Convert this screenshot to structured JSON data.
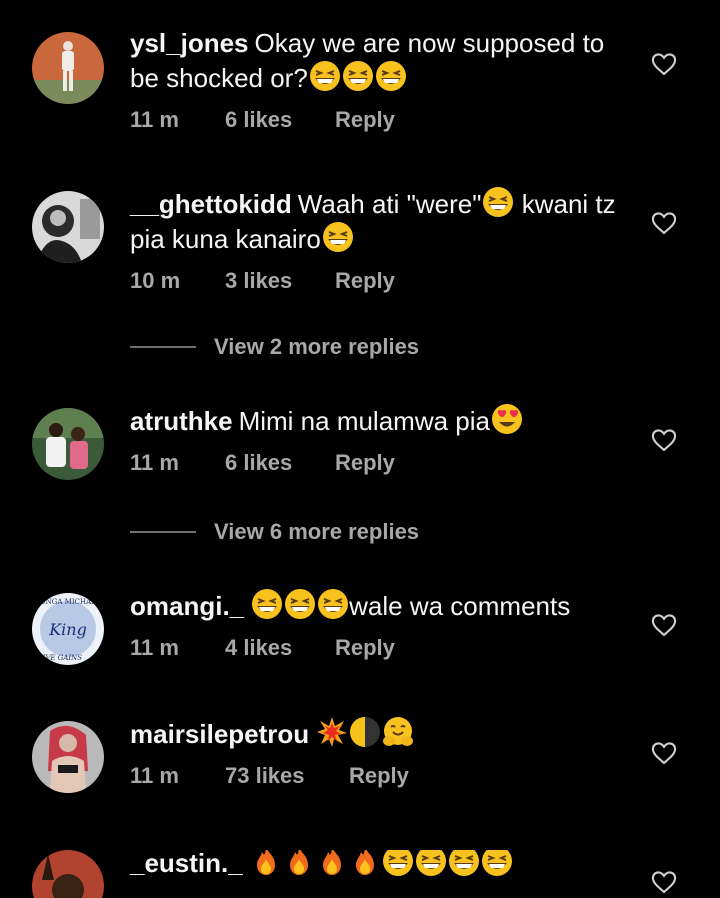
{
  "comments": [
    {
      "username": "ysl_jones",
      "text": "Okay we are now supposed to be shocked or?",
      "emojis_after": [
        "grinning-squint-emoji",
        "grinning-squint-emoji",
        "grinning-squint-emoji"
      ],
      "time": "11 m",
      "likes": "6 likes",
      "reply": "Reply"
    },
    {
      "username": "__ghettokidd",
      "text_a": "Waah ati \"were\"",
      "text_b": " kwani tz pia kuna kanairo",
      "time": "10 m",
      "likes": "3 likes",
      "reply": "Reply",
      "view_more": "View 2 more replies"
    },
    {
      "username": "atruthke",
      "text": "Mimi na mulamwa pia",
      "time": "11 m",
      "likes": "6 likes",
      "reply": "Reply",
      "view_more": "View 6 more replies"
    },
    {
      "username": "omangi._",
      "text": "wale wa comments",
      "time": "11 m",
      "likes": "4 likes",
      "reply": "Reply",
      "avatar_text": {
        "top": "TUNGA MICHAEL",
        "script": "King",
        "bottom": "LIVE GAINS"
      }
    },
    {
      "username": "mairsilepetrou",
      "time": "11 m",
      "likes": "73 likes",
      "reply": "Reply"
    },
    {
      "username": "_eustin._"
    }
  ],
  "colors": {
    "background": "#000000",
    "text": "#f5f5f5",
    "muted": "#a8a8a8"
  }
}
